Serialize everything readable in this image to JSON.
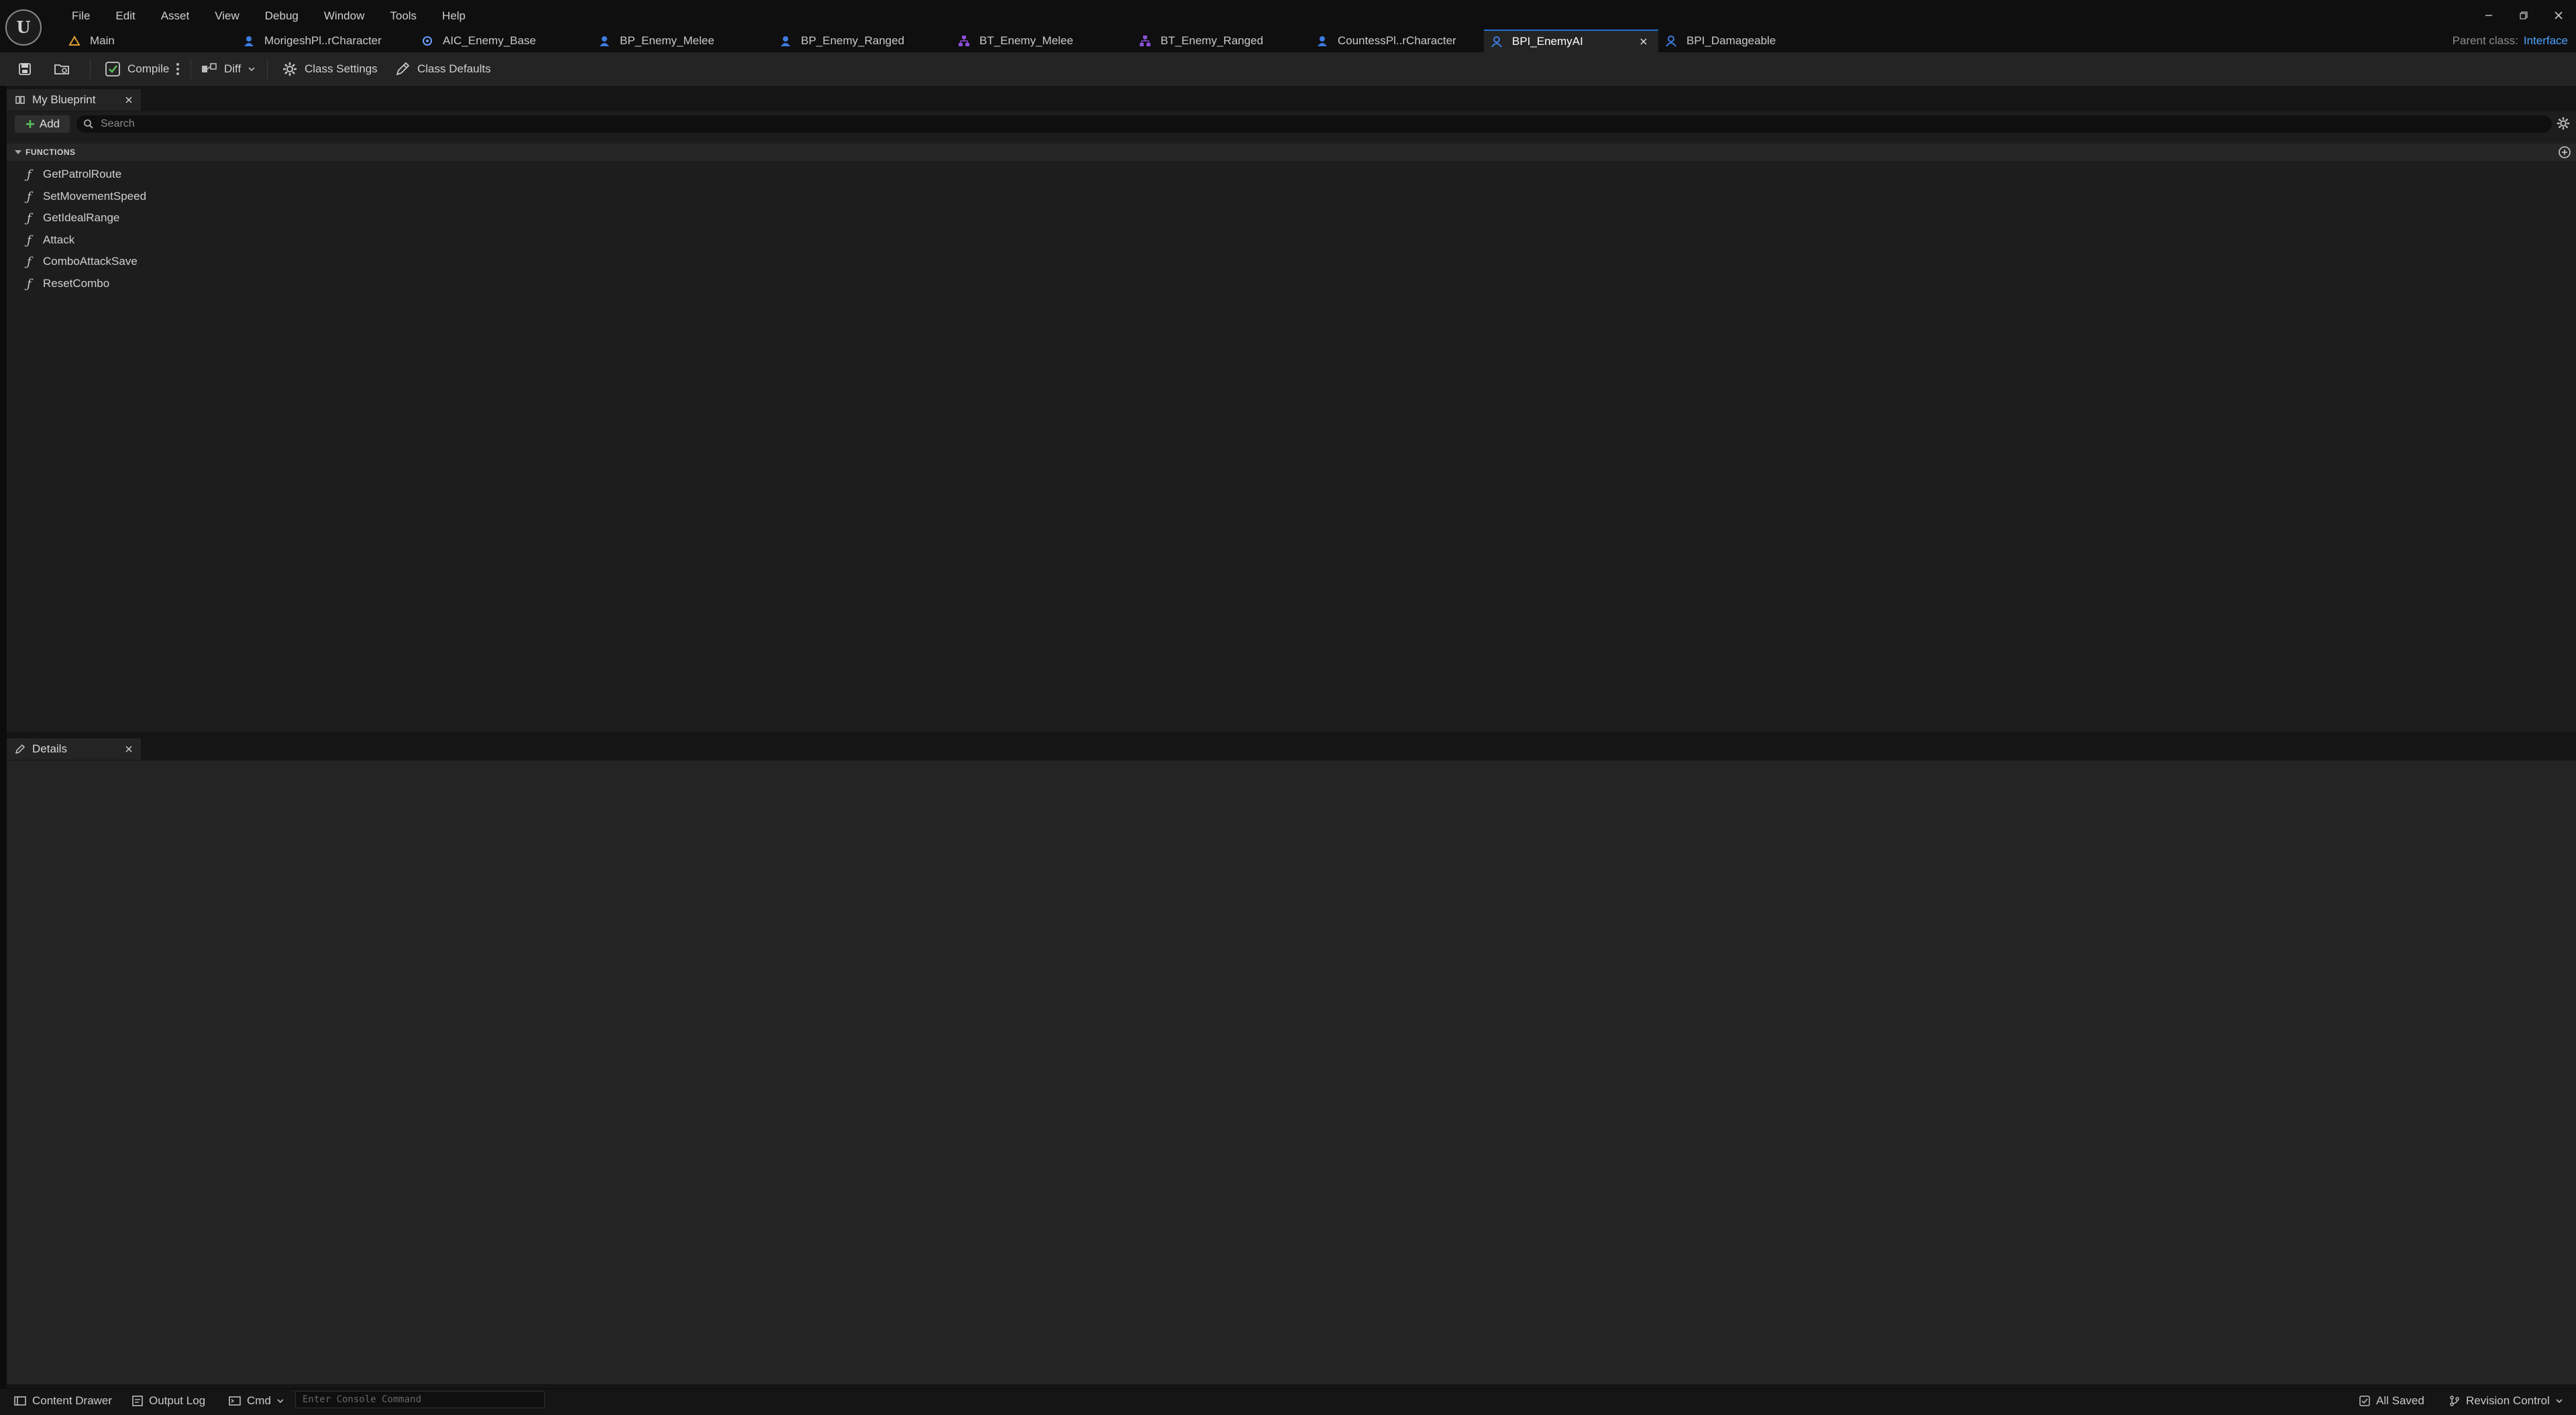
{
  "menu": [
    "File",
    "Edit",
    "Asset",
    "View",
    "Debug",
    "Window",
    "Tools",
    "Help"
  ],
  "tabs": [
    {
      "label": "Main",
      "icon": "level-icon",
      "color": "#e0a030"
    },
    {
      "label": "MorigeshPl..rCharacter",
      "icon": "blueprint-actor-icon",
      "color": "#3d7be0"
    },
    {
      "label": "AIC_Enemy_Base",
      "icon": "ai-controller-icon",
      "color": "#6aa0ff"
    },
    {
      "label": "BP_Enemy_Melee",
      "icon": "blueprint-actor-icon",
      "color": "#3d7be0"
    },
    {
      "label": "BP_Enemy_Ranged",
      "icon": "blueprint-actor-icon",
      "color": "#3d7be0"
    },
    {
      "label": "BT_Enemy_Melee",
      "icon": "behavior-tree-icon",
      "color": "#8a4fd8"
    },
    {
      "label": "BT_Enemy_Ranged",
      "icon": "behavior-tree-icon",
      "color": "#8a4fd8"
    },
    {
      "label": "CountessPl..rCharacter",
      "icon": "blueprint-actor-icon",
      "color": "#3d7be0"
    },
    {
      "label": "BPI_EnemyAI",
      "icon": "blueprint-interface-icon",
      "color": "#3d7be0",
      "active": true
    },
    {
      "label": "BPI_Damageable",
      "icon": "blueprint-interface-icon",
      "color": "#3d7be0"
    }
  ],
  "parent_class": {
    "label": "Parent class:",
    "value": "Interface"
  },
  "toolbar": {
    "compile": "Compile",
    "diff": "Diff",
    "class_settings": "Class Settings",
    "class_defaults": "Class Defaults"
  },
  "my_blueprint": {
    "tab_label": "My Blueprint",
    "add_label": "Add",
    "search_placeholder": "Search",
    "section_title": "FUNCTIONS",
    "functions": [
      "GetPatrolRoute",
      "SetMovementSpeed",
      "GetIdealRange",
      "Attack",
      "ComboAttackSave",
      "ResetCombo"
    ]
  },
  "details": {
    "tab_label": "Details"
  },
  "status_bar": {
    "content_drawer": "Content Drawer",
    "output_log": "Output Log",
    "cmd": "Cmd",
    "console_placeholder": "Enter Console Command",
    "all_saved": "All Saved",
    "revision_control": "Revision Control"
  },
  "colors": {
    "accent": "#4ea3ff",
    "active_tab_border": "#1f6fd0",
    "add_plus": "#5cc05c"
  }
}
